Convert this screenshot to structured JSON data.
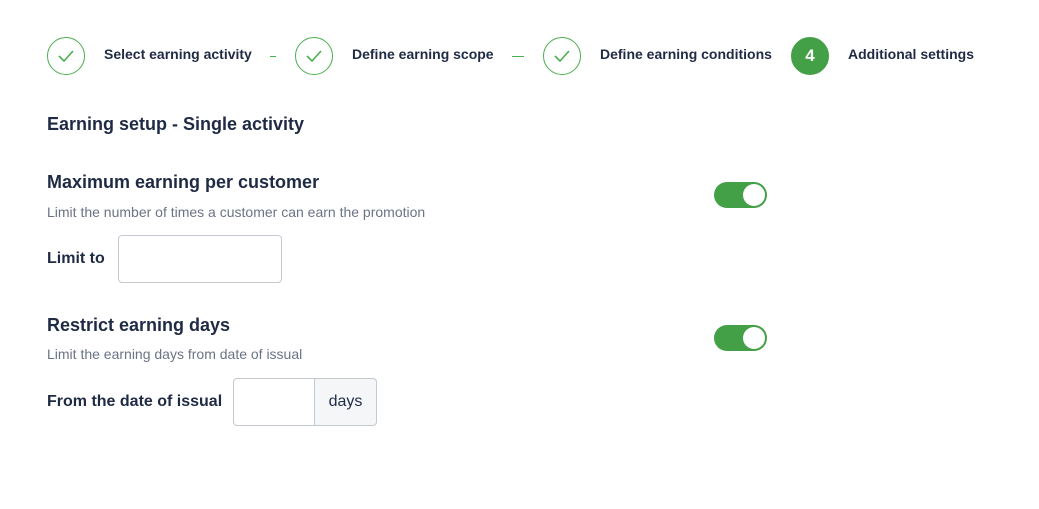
{
  "stepper": {
    "steps": [
      {
        "label": "Select earning activity",
        "status": "complete"
      },
      {
        "label": "Define earning scope",
        "status": "complete"
      },
      {
        "label": "Define earning conditions",
        "status": "complete"
      },
      {
        "label": "Additional settings",
        "status": "current",
        "number": "4"
      }
    ]
  },
  "main": {
    "section_title": "Earning setup - Single activity",
    "max_earning": {
      "title": "Maximum earning per customer",
      "description": "Limit the number of times a customer can earn the promotion",
      "field_label": "Limit to",
      "value": "",
      "toggle_on": true
    },
    "restrict_days": {
      "title": "Restrict earning days",
      "description": "Limit the earning days from date of issual",
      "field_label": "From the date of issual",
      "value": "",
      "unit": "days",
      "toggle_on": true
    }
  },
  "colors": {
    "accent": "#43a047",
    "text": "#1f2a44",
    "muted": "#6b7385"
  }
}
